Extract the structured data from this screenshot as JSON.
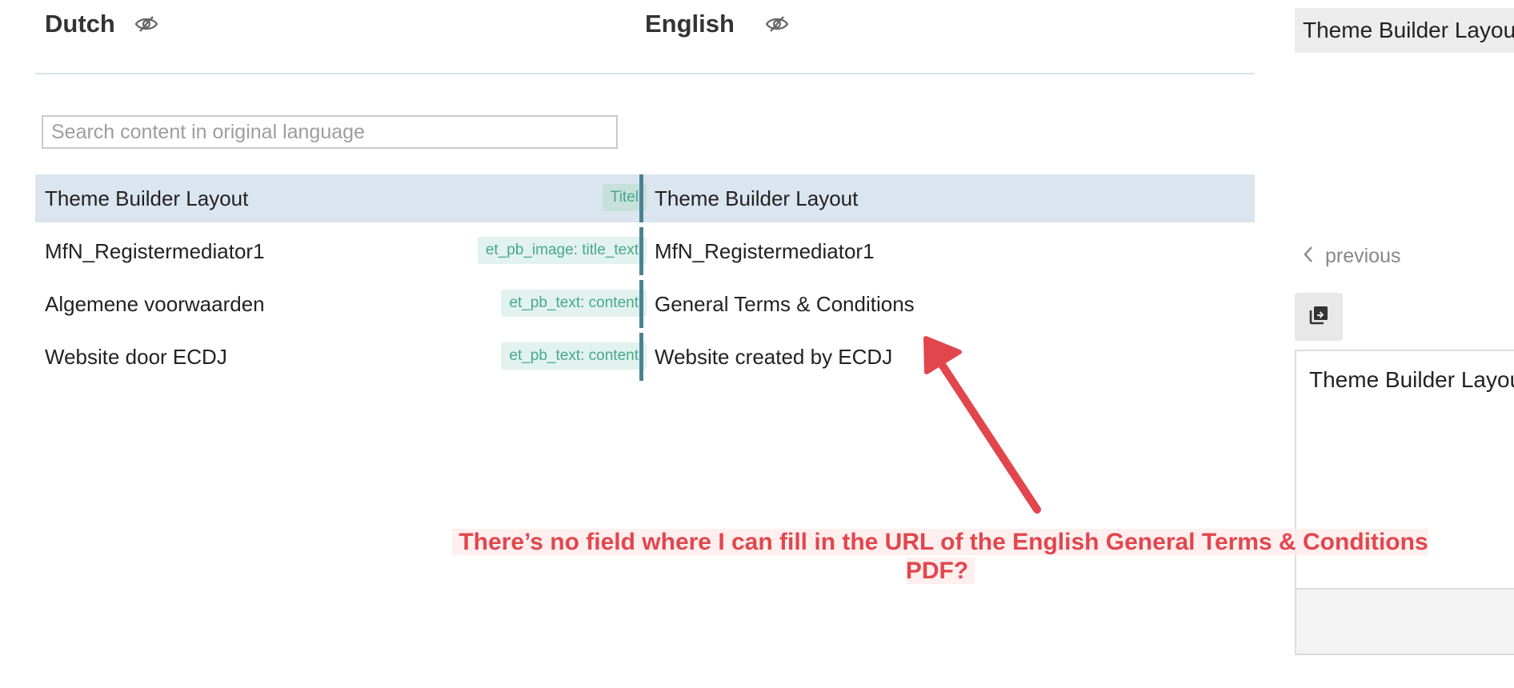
{
  "columns": {
    "source": {
      "title": "Dutch",
      "icon": "eye-slash-icon"
    },
    "target": {
      "title": "English",
      "icon": "eye-slash-icon"
    }
  },
  "search": {
    "placeholder": "Search content in original language",
    "value": ""
  },
  "rows": [
    {
      "source": "Theme Builder Layout",
      "tag": "Titel",
      "target": "Theme Builder Layout",
      "active": true
    },
    {
      "source": "MfN_Registermediator1",
      "tag": "et_pb_image: title_text",
      "target": "MfN_Registermediator1",
      "active": false
    },
    {
      "source": "Algemene voorwaarden",
      "tag": "et_pb_text: content",
      "target": "General Terms & Conditions",
      "active": false
    },
    {
      "source": "Website door ECDJ",
      "tag": "et_pb_text: content",
      "target": "Website created by ECDJ",
      "active": false
    }
  ],
  "side_panel": {
    "title": "Theme Builder Layout",
    "previous_label": "previous",
    "previous_icon": "chevron-left-icon",
    "copy_icon": "copy-icon",
    "editor_text": "Theme Builder Layout"
  },
  "annotation": {
    "text": "There’s no field where I can fill in the URL of the English General Terms & Conditions PDF?",
    "color": "#e2464d"
  },
  "colors": {
    "accent_bar": "#4e8190",
    "active_row": "#dae5ef",
    "tag_text": "#45a98e",
    "tag_bg": "#e2f2ee"
  }
}
